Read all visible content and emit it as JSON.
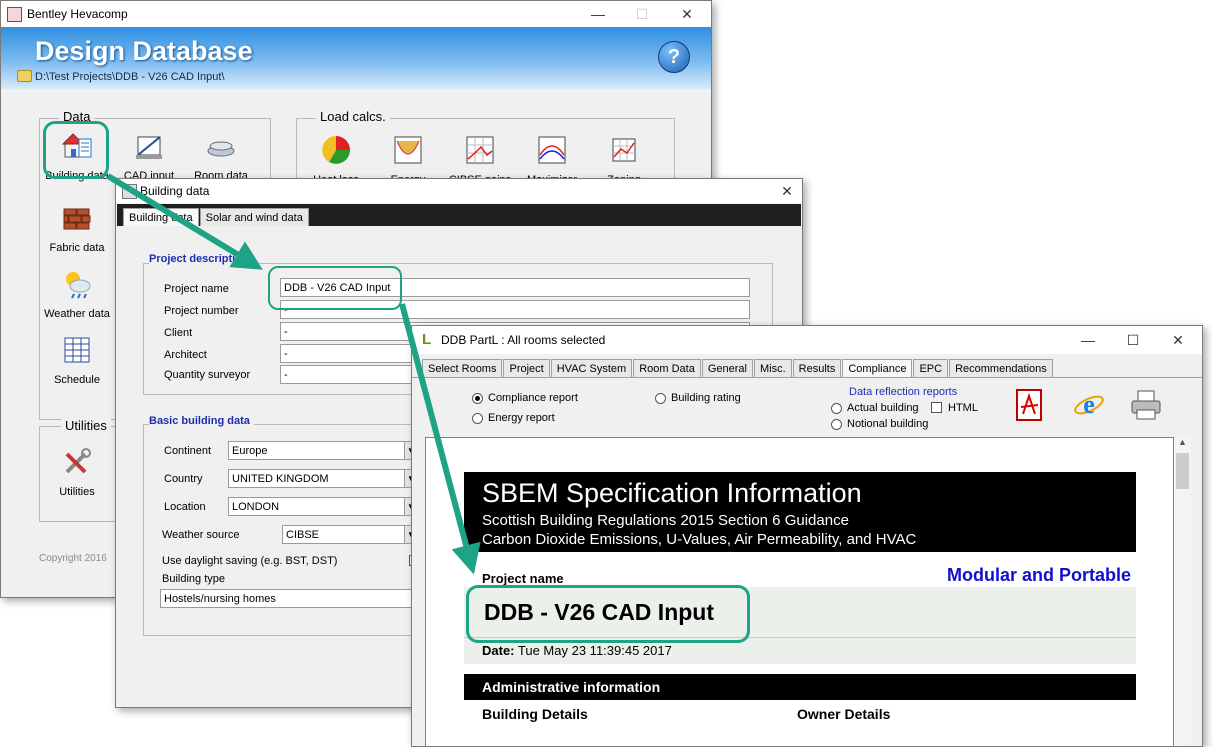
{
  "colors": {
    "accent_green": "#1ea386",
    "header_blue": "#2f8fe0",
    "section_blue": "#1c2eb0",
    "report_link_blue": "#1010cc"
  },
  "win1": {
    "title": "Bentley Hevacomp",
    "header_title": "Design Database",
    "path": "D:\\Test Projects\\DDB - V26 CAD Input\\",
    "help": "?",
    "group_data": "Data",
    "group_load": "Load calcs.",
    "group_utilities": "Utilities",
    "tiles": {
      "building_data": "Building data",
      "cad_input": "CAD input",
      "room_data": "Room data",
      "fabric_data": "Fabric data",
      "weather_data": "Weather data",
      "schedule": "Schedule",
      "utilities": "Utilities",
      "heat_loss": "Heat loss",
      "energy": "Energy",
      "cibse": "CIBSE gains",
      "maximizer": "Maximizer",
      "zoning": "Zoning"
    },
    "copyright": "Copyright 2016"
  },
  "win2": {
    "title": "Building data",
    "tabs": [
      "Building data",
      "Solar and wind data"
    ],
    "section_project": "Project description",
    "labels": {
      "project_name": "Project name",
      "project_number": "Project number",
      "client": "Client",
      "architect": "Architect",
      "quantity_surveyor": "Quantity surveyor"
    },
    "values": {
      "project_name": "DDB - V26 CAD Input",
      "project_number": "-",
      "client": "-",
      "architect": "-",
      "quantity_surveyor": "-"
    },
    "section_basic": "Basic building data",
    "basic_labels": {
      "continent": "Continent",
      "country": "Country",
      "location": "Location",
      "weather_source": "Weather source",
      "daylight": "Use daylight saving (e.g. BST, DST)",
      "building_type": "Building type"
    },
    "basic_values": {
      "continent": "Europe",
      "country": "UNITED KINGDOM",
      "location": "LONDON",
      "weather_source": "CIBSE",
      "building_type": "Hostels/nursing homes"
    }
  },
  "win3": {
    "title": "DDB PartL : All rooms selected",
    "tabs": [
      "Select Rooms",
      "Project",
      "HVAC System",
      "Room Data",
      "General",
      "Misc.",
      "Results",
      "Compliance",
      "EPC",
      "Recommendations"
    ],
    "options": {
      "compliance_report": "Compliance report",
      "energy_report": "Energy report",
      "building_rating": "Building rating",
      "data_reflection": "Data reflection reports",
      "actual_building": "Actual building",
      "html": "HTML",
      "notional_building": "Notional building"
    },
    "report": {
      "title": "SBEM Specification Information",
      "subtitle1": "Scottish Building Regulations 2015 Section 6 Guidance",
      "subtitle2": "Carbon Dioxide Emissions, U-Values, Air Permeability, and HVAC",
      "project_name_label": "Project name",
      "category": "Modular and Portable",
      "project_name_value": "DDB - V26 CAD Input",
      "date_label": "Date:",
      "date_value": "Tue May 23 11:39:45 2017",
      "admin_heading": "Administrative information",
      "building_details": "Building Details",
      "owner_details": "Owner Details"
    }
  }
}
